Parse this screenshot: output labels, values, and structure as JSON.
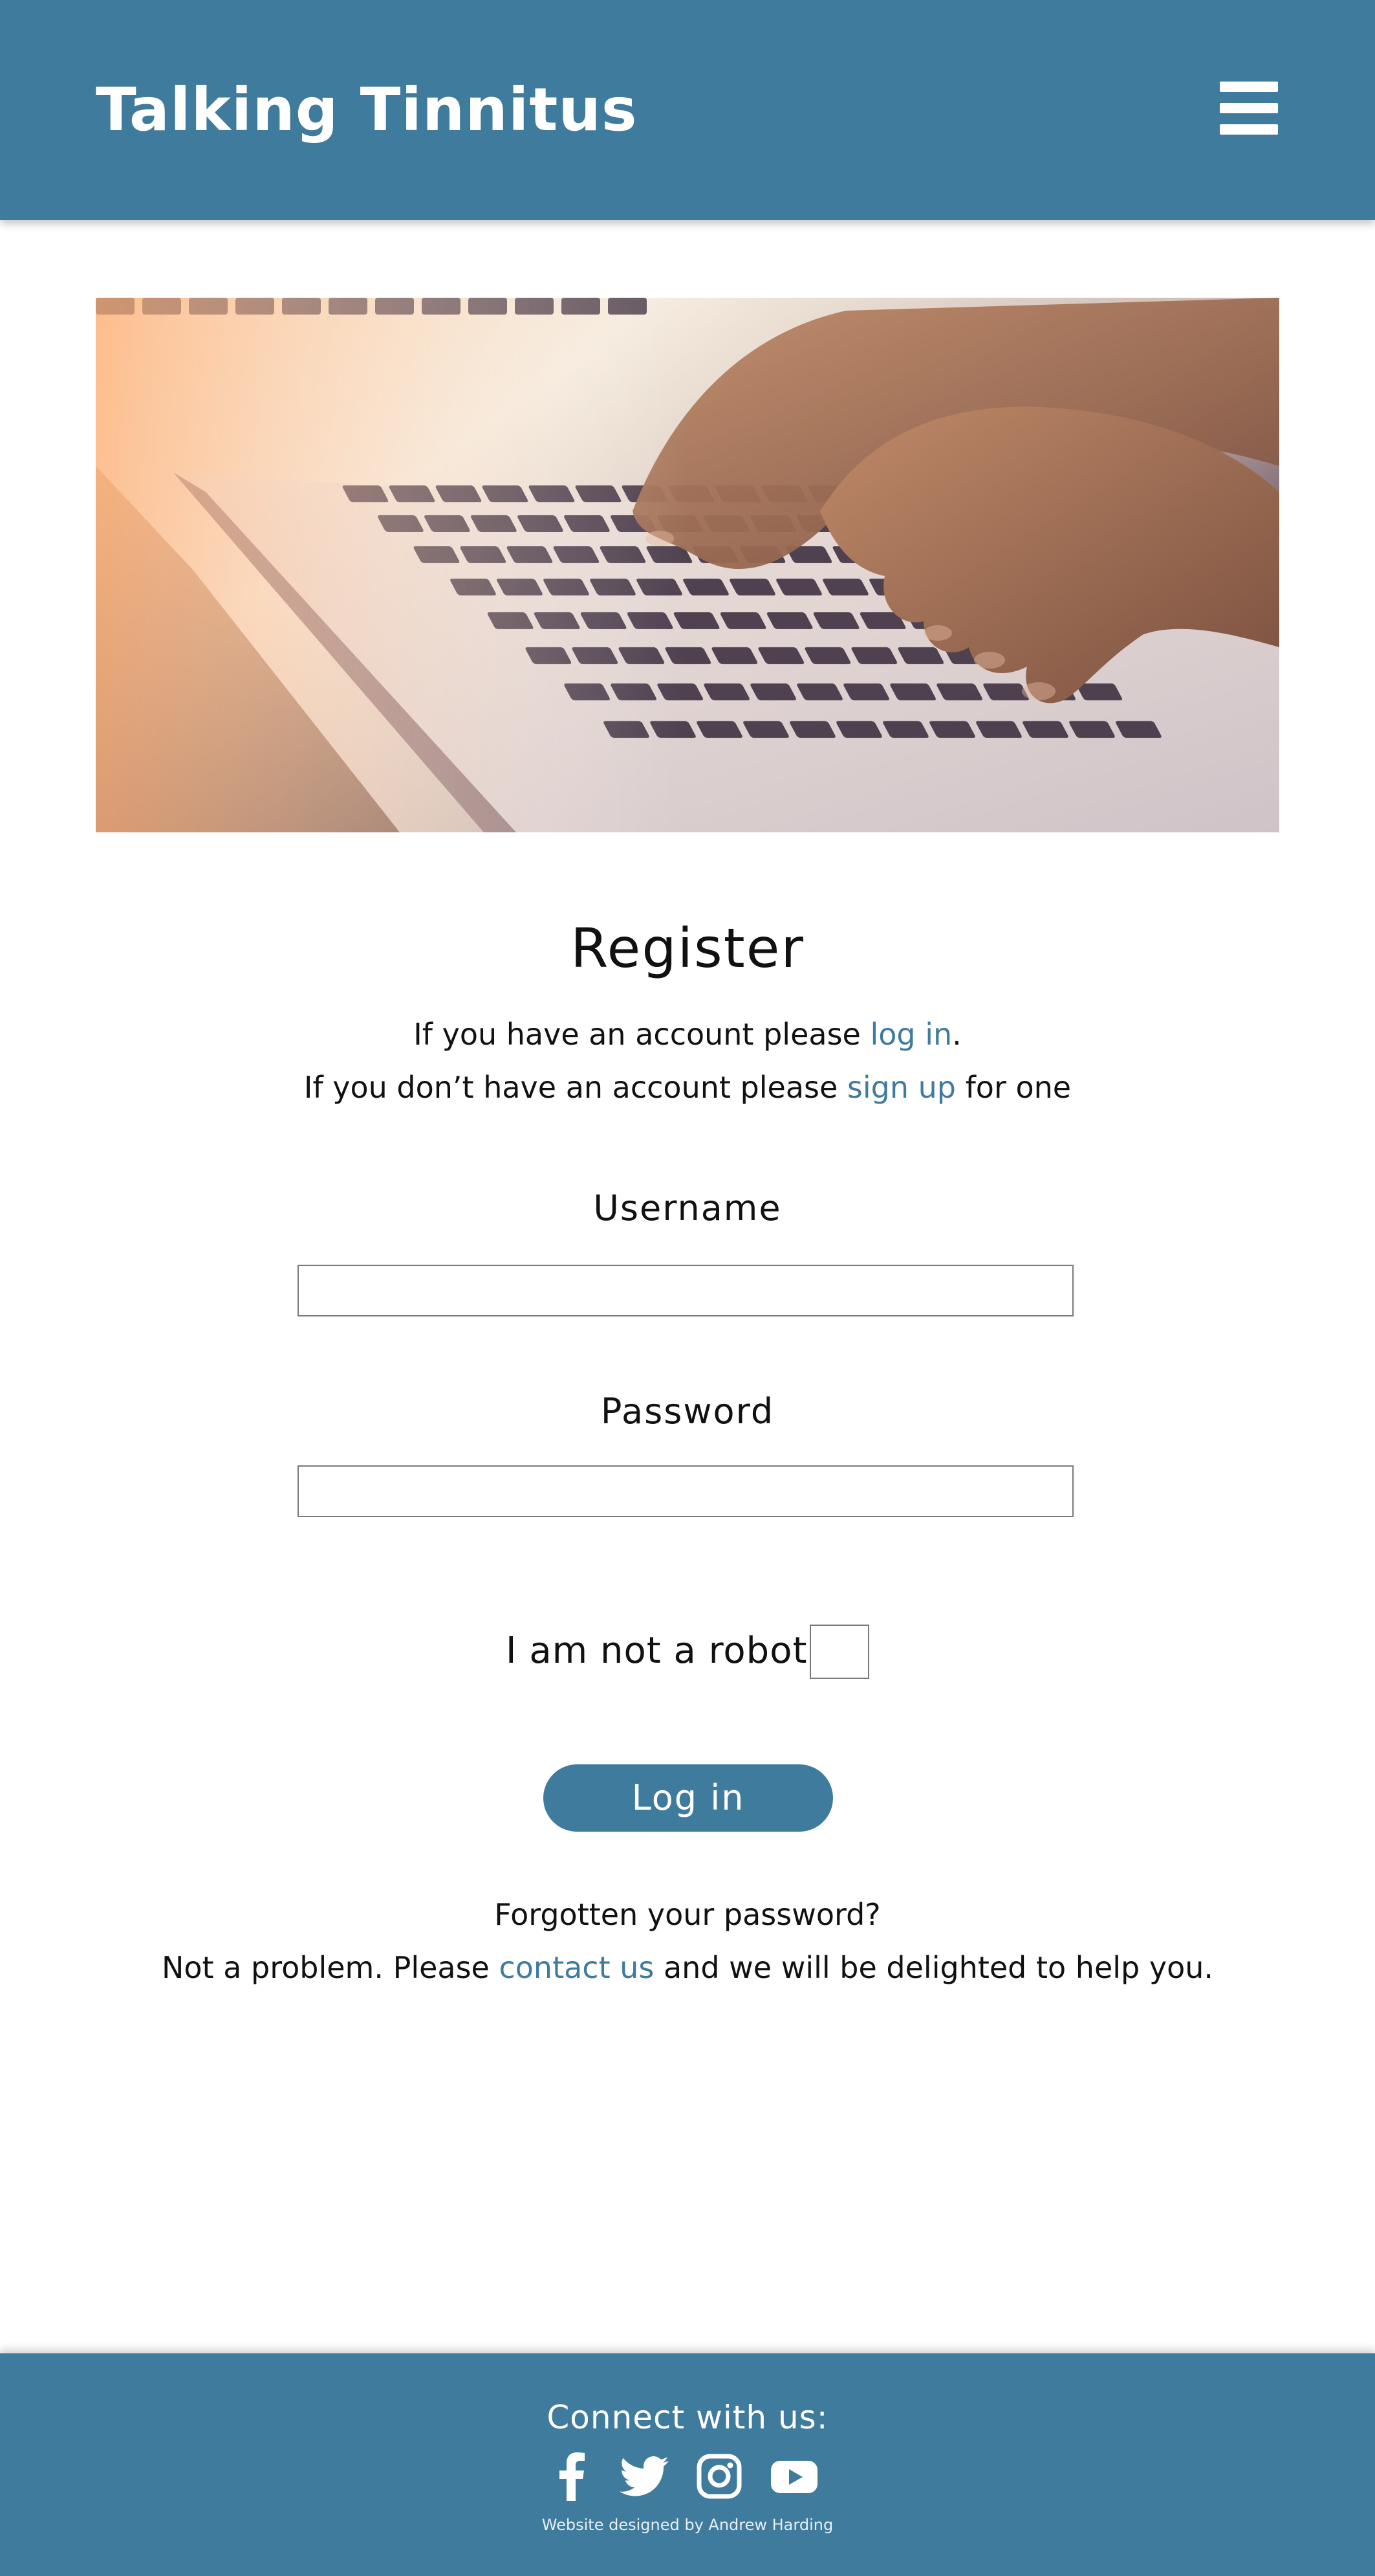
{
  "header": {
    "site_title": "Talking Tinnitus",
    "menu_icon": "hamburger-menu-icon"
  },
  "hero": {
    "image": "hands-typing-on-laptop-photo"
  },
  "register": {
    "title": "Register",
    "line1_prefix": "If you have an account please ",
    "line1_link": "log in",
    "line1_suffix": ".",
    "line2_prefix": "If you don’t have an account please ",
    "line2_link": "sign up",
    "line2_suffix": " for one"
  },
  "form": {
    "username_label": "Username",
    "username_value": "",
    "password_label": "Password",
    "password_value": "",
    "robot_label": "I am not a robot",
    "robot_checked": false,
    "submit_label": "Log in"
  },
  "help": {
    "line1": "Forgotten your password?",
    "line2_prefix": "Not a problem. Please ",
    "line2_link": "contact us",
    "line2_suffix": " and we will be delighted to help you."
  },
  "footer": {
    "connect": "Connect with us:",
    "socials": [
      "facebook-icon",
      "twitter-icon",
      "instagram-icon",
      "youtube-icon"
    ],
    "credit": "Website designed by Andrew Harding"
  },
  "colors": {
    "brand": "#3f7b9c",
    "text": "#111111",
    "background": "#ffffff"
  }
}
